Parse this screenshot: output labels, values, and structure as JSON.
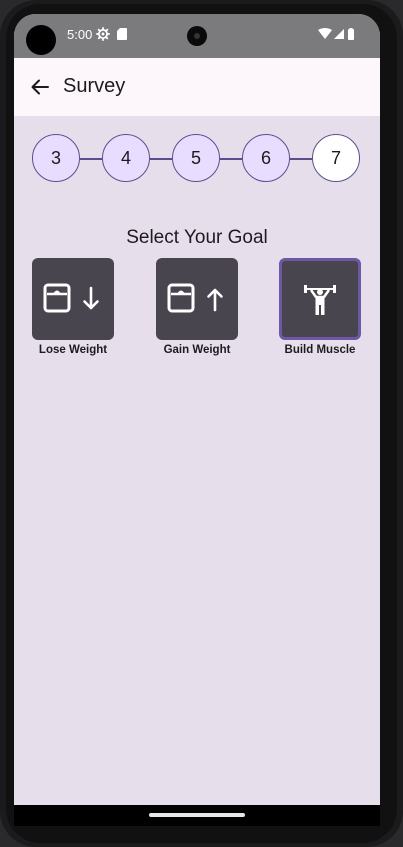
{
  "status_bar": {
    "time": "5:00",
    "icons": [
      "settings-gear-icon",
      "sd-card-icon",
      "wifi-icon",
      "signal-icon",
      "battery-icon"
    ]
  },
  "app_bar": {
    "title": "Survey",
    "back_icon": "arrow-back-icon"
  },
  "stepper": {
    "steps": [
      "3",
      "4",
      "5",
      "6",
      "7"
    ],
    "current_step": "7"
  },
  "goal_section": {
    "title": "Select Your Goal",
    "options": [
      {
        "label": "Lose Weight",
        "icon": "scale-arrow-down-icon",
        "selected": false
      },
      {
        "label": "Gain Weight",
        "icon": "scale-arrow-up-icon",
        "selected": false
      },
      {
        "label": "Build Muscle",
        "icon": "weightlifter-icon",
        "selected": true
      }
    ]
  },
  "colors": {
    "background": "#e6dfeb",
    "app_bar": "#fdf7fc",
    "step_fill": "#e9ddff",
    "step_border": "#5f4c8f",
    "goal_tile": "#49454f",
    "selected_border": "#6c58a6"
  }
}
